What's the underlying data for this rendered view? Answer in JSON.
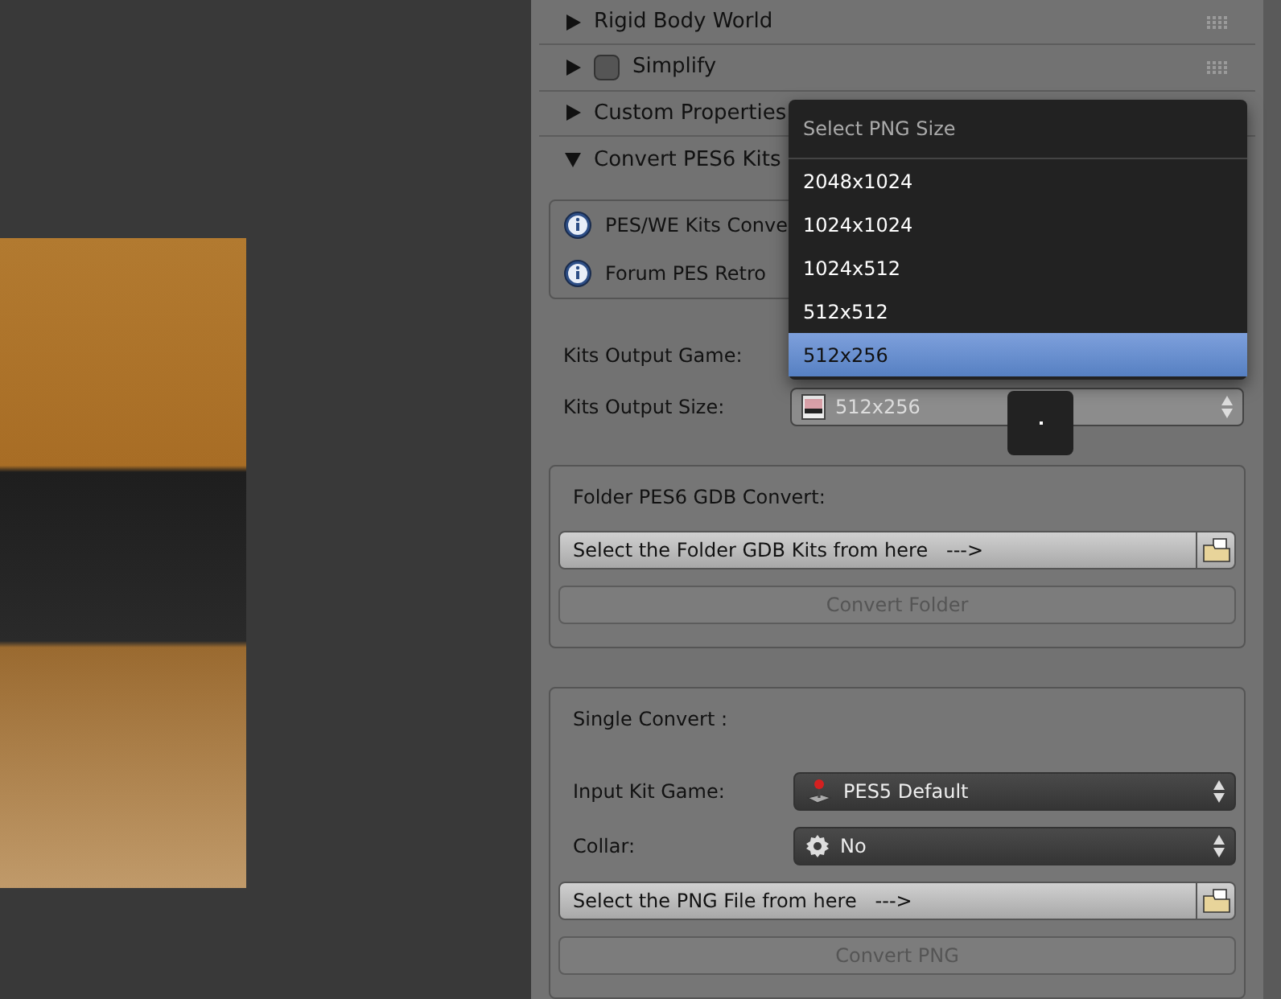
{
  "panels": [
    {
      "kind": "plain",
      "title": "Rigid Body World",
      "expanded": false
    },
    {
      "kind": "checkbox",
      "title": "Simplify",
      "expanded": false,
      "checked": false
    },
    {
      "kind": "plain",
      "title": "Custom Properties",
      "expanded": false
    },
    {
      "kind": "plain",
      "title": "Convert PES6 Kits",
      "expanded": true
    }
  ],
  "info": [
    "PES/WE Kits Conve",
    "Forum PES Retro"
  ],
  "output": {
    "game_label": "Kits Output Game:",
    "size_label": "Kits Output Size:",
    "size_value": "512x256"
  },
  "menu": {
    "title": "Select PNG Size",
    "items": [
      {
        "label": "2048x1024",
        "selected": false
      },
      {
        "label": "1024x1024",
        "selected": false
      },
      {
        "label": "1024x512",
        "selected": false
      },
      {
        "label": "512x512",
        "selected": false
      },
      {
        "label": "512x256",
        "selected": true
      }
    ]
  },
  "folder": {
    "title": "Folder PES6 GDB Convert:",
    "path": "Select the Folder GDB Kits from here   --->",
    "button": "Convert Folder",
    "disabled": true
  },
  "single": {
    "title": "Single Convert :",
    "game_label": "Input Kit Game:",
    "game_value": "PES5 Default",
    "collar_label": "Collar:",
    "collar_value": "No",
    "path": "Select the PNG File from here   --->",
    "button": "Convert PNG",
    "disabled": true
  }
}
